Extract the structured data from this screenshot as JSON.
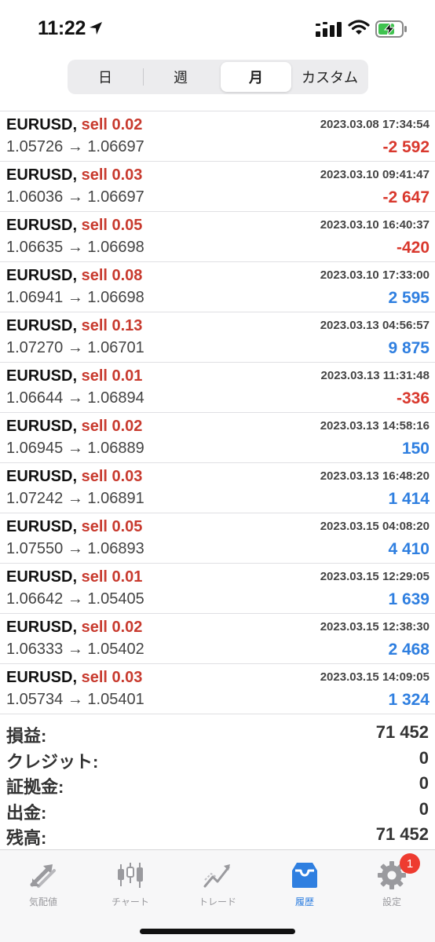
{
  "status_bar": {
    "time": "11:22",
    "icons": [
      "location-arrow-icon",
      "cellular-signal-icon",
      "wifi-icon",
      "battery-charging-icon"
    ]
  },
  "period_tabs": {
    "items": [
      {
        "label": "日"
      },
      {
        "label": "週"
      },
      {
        "label": "月"
      },
      {
        "label": "カスタム"
      }
    ],
    "selected": "月"
  },
  "trades": [
    {
      "symbol": "EURUSD,",
      "side": "sell 0.02",
      "time": "2023.03.08 17:34:54",
      "open": "1.05726",
      "arrow": "→",
      "close": "1.06697",
      "profit": "-2 592",
      "positive": false
    },
    {
      "symbol": "EURUSD,",
      "side": "sell 0.03",
      "time": "2023.03.10 09:41:47",
      "open": "1.06036",
      "arrow": "→",
      "close": "1.06697",
      "profit": "-2 647",
      "positive": false
    },
    {
      "symbol": "EURUSD,",
      "side": "sell 0.05",
      "time": "2023.03.10 16:40:37",
      "open": "1.06635",
      "arrow": "→",
      "close": "1.06698",
      "profit": "-420",
      "positive": false
    },
    {
      "symbol": "EURUSD,",
      "side": "sell 0.08",
      "time": "2023.03.10 17:33:00",
      "open": "1.06941",
      "arrow": "→",
      "close": "1.06698",
      "profit": "2 595",
      "positive": true
    },
    {
      "symbol": "EURUSD,",
      "side": "sell 0.13",
      "time": "2023.03.13 04:56:57",
      "open": "1.07270",
      "arrow": "→",
      "close": "1.06701",
      "profit": "9 875",
      "positive": true
    },
    {
      "symbol": "EURUSD,",
      "side": "sell 0.01",
      "time": "2023.03.13 11:31:48",
      "open": "1.06644",
      "arrow": "→",
      "close": "1.06894",
      "profit": "-336",
      "positive": false
    },
    {
      "symbol": "EURUSD,",
      "side": "sell 0.02",
      "time": "2023.03.13 14:58:16",
      "open": "1.06945",
      "arrow": "→",
      "close": "1.06889",
      "profit": "150",
      "positive": true
    },
    {
      "symbol": "EURUSD,",
      "side": "sell 0.03",
      "time": "2023.03.13 16:48:20",
      "open": "1.07242",
      "arrow": "→",
      "close": "1.06891",
      "profit": "1 414",
      "positive": true
    },
    {
      "symbol": "EURUSD,",
      "side": "sell 0.05",
      "time": "2023.03.15 04:08:20",
      "open": "1.07550",
      "arrow": "→",
      "close": "1.06893",
      "profit": "4 410",
      "positive": true
    },
    {
      "symbol": "EURUSD,",
      "side": "sell 0.01",
      "time": "2023.03.15 12:29:05",
      "open": "1.06642",
      "arrow": "→",
      "close": "1.05405",
      "profit": "1 639",
      "positive": true
    },
    {
      "symbol": "EURUSD,",
      "side": "sell 0.02",
      "time": "2023.03.15 12:38:30",
      "open": "1.06333",
      "arrow": "→",
      "close": "1.05402",
      "profit": "2 468",
      "positive": true
    },
    {
      "symbol": "EURUSD,",
      "side": "sell 0.03",
      "time": "2023.03.15 14:09:05",
      "open": "1.05734",
      "arrow": "→",
      "close": "1.05401",
      "profit": "1 324",
      "positive": true
    }
  ],
  "summary": [
    {
      "label": "損益:",
      "value": "71 452"
    },
    {
      "label": "クレジット:",
      "value": "0"
    },
    {
      "label": "証拠金:",
      "value": "0"
    },
    {
      "label": "出金:",
      "value": "0"
    },
    {
      "label": "残高:",
      "value": "71 452"
    }
  ],
  "tab_bar": {
    "items": [
      {
        "label": "気配値",
        "icon": "quotes-arrows-icon"
      },
      {
        "label": "チャート",
        "icon": "candlestick-chart-icon"
      },
      {
        "label": "トレード",
        "icon": "trade-chart-icon"
      },
      {
        "label": "履歴",
        "icon": "history-inbox-icon"
      },
      {
        "label": "設定",
        "icon": "gear-icon"
      }
    ],
    "active": "履歴",
    "settings_badge": "1"
  },
  "colors": {
    "sell": "#c83a2e",
    "loss": "#d9382d",
    "gain": "#2f7fe0",
    "active_tab": "#2f7fe0",
    "inactive_tab": "#9a9a9e",
    "badge": "#ee3b30"
  }
}
